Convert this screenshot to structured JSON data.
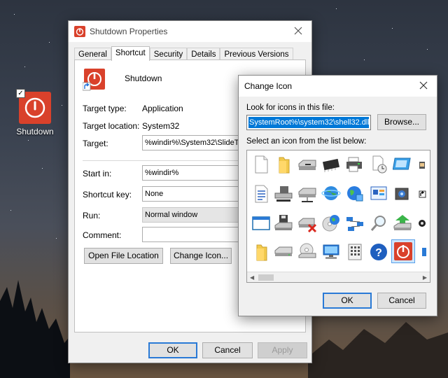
{
  "desktop": {
    "icon_label": "Shutdown"
  },
  "props": {
    "title": "Shutdown Properties",
    "tabs": [
      {
        "label": "General"
      },
      {
        "label": "Shortcut"
      },
      {
        "label": "Security"
      },
      {
        "label": "Details"
      },
      {
        "label": "Previous Versions"
      }
    ],
    "active_tab": "Shortcut",
    "name": "Shutdown",
    "target_type_label": "Target type:",
    "target_type_value": "Application",
    "target_location_label": "Target location:",
    "target_location_value": "System32",
    "target_label": "Target:",
    "target_value": "%windir%\\System32\\SlideToSh",
    "start_in_label": "Start in:",
    "start_in_value": "%windir%",
    "shortcut_key_label": "Shortcut key:",
    "shortcut_key_value": "None",
    "run_label": "Run:",
    "run_value": "Normal window",
    "comment_label": "Comment:",
    "comment_value": "",
    "open_location_button": "Open File Location",
    "change_icon_button": "Change Icon...",
    "ok_button": "OK",
    "cancel_button": "Cancel",
    "apply_button": "Apply"
  },
  "change_icon": {
    "title": "Change Icon",
    "look_label": "Look for icons in this file:",
    "file_value": "SystemRoot%\\system32\\shell32.dll",
    "browse_button": "Browse...",
    "select_label": "Select an icon from the list below:",
    "ok_button": "OK",
    "cancel_button": "Cancel",
    "icons": [
      "blank-document-icon",
      "folder-icon",
      "floppy-drive-icon",
      "memory-chip-icon",
      "printer-icon",
      "file-clock-icon",
      "display-icon",
      "monitor-partial-icon",
      "text-document-icon",
      "network-drive-icon",
      "network-drive-disconnected-icon",
      "network-globe-icon",
      "internet-globe-icon",
      "control-panel-icon",
      "camera-chip-icon",
      "shortcut-overlay-icon",
      "window-icon",
      "floppy-stack-icon",
      "drive-remove-icon",
      "cd-globe-icon",
      "network-connection-icon",
      "search-icon",
      "arrow-drive-icon",
      "camera-small-icon",
      "folder-half-icon",
      "hard-drive-icon",
      "cd-drive-icon",
      "computer-icon",
      "keypad-icon",
      "help-icon",
      "power-icon",
      "partial-icon"
    ],
    "selected_icon": "power-icon"
  }
}
